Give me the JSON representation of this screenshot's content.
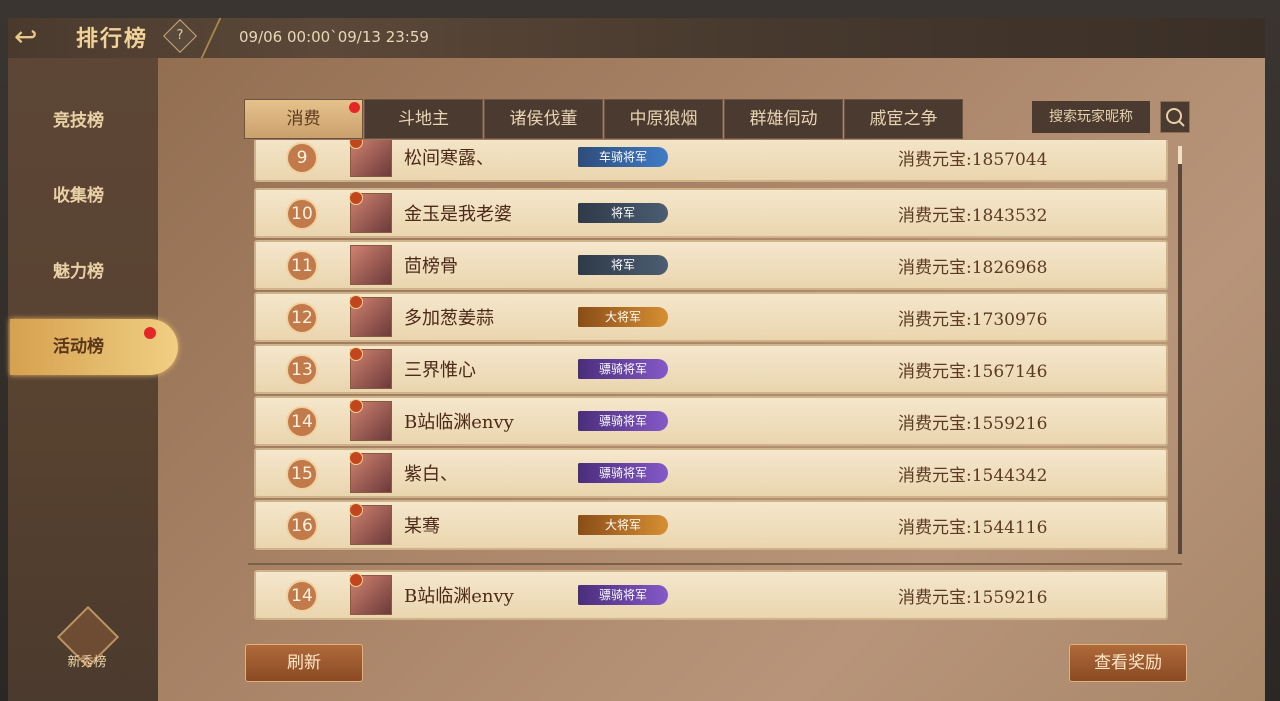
{
  "header": {
    "title": "排行榜",
    "help": "?",
    "date_range": "09/06 00:00`09/13 23:59"
  },
  "sidebar": {
    "items": [
      {
        "label": "竞技榜"
      },
      {
        "label": "收集榜"
      },
      {
        "label": "魅力榜"
      },
      {
        "label": "活动榜"
      }
    ],
    "newbie_label": "新秀榜"
  },
  "tabs": [
    "消费",
    "斗地主",
    "诸侯伐董",
    "中原狼烟",
    "群雄伺动",
    "戚宦之争"
  ],
  "search": {
    "label": "搜索玩家昵称"
  },
  "rows": [
    {
      "rank": "9",
      "name": "松间寒露、",
      "badge": "车骑将军",
      "score": "消费元宝:1857044"
    },
    {
      "rank": "10",
      "name": "金玉是我老婆",
      "badge": "将军",
      "score": "消费元宝:1843532"
    },
    {
      "rank": "11",
      "name": "茴榜骨",
      "badge": "将军",
      "score": "消费元宝:1826968"
    },
    {
      "rank": "12",
      "name": "多加葱姜蒜",
      "badge": "大将军",
      "score": "消费元宝:1730976"
    },
    {
      "rank": "13",
      "name": "三界惟心",
      "badge": "骠骑将军",
      "score": "消费元宝:1567146"
    },
    {
      "rank": "14",
      "name": "B站临渊envy",
      "badge": "骠骑将军",
      "score": "消费元宝:1559216"
    },
    {
      "rank": "15",
      "name": "紫白、",
      "badge": "骠骑将军",
      "score": "消费元宝:1544342"
    },
    {
      "rank": "16",
      "name": "某骞",
      "badge": "大将军",
      "score": "消费元宝:1544116"
    }
  ],
  "my_row": {
    "rank": "14",
    "name": "B站临渊envy",
    "badge": "骠骑将军",
    "score": "消费元宝:1559216"
  },
  "buttons": {
    "refresh": "刷新",
    "rewards": "查看奖励"
  }
}
